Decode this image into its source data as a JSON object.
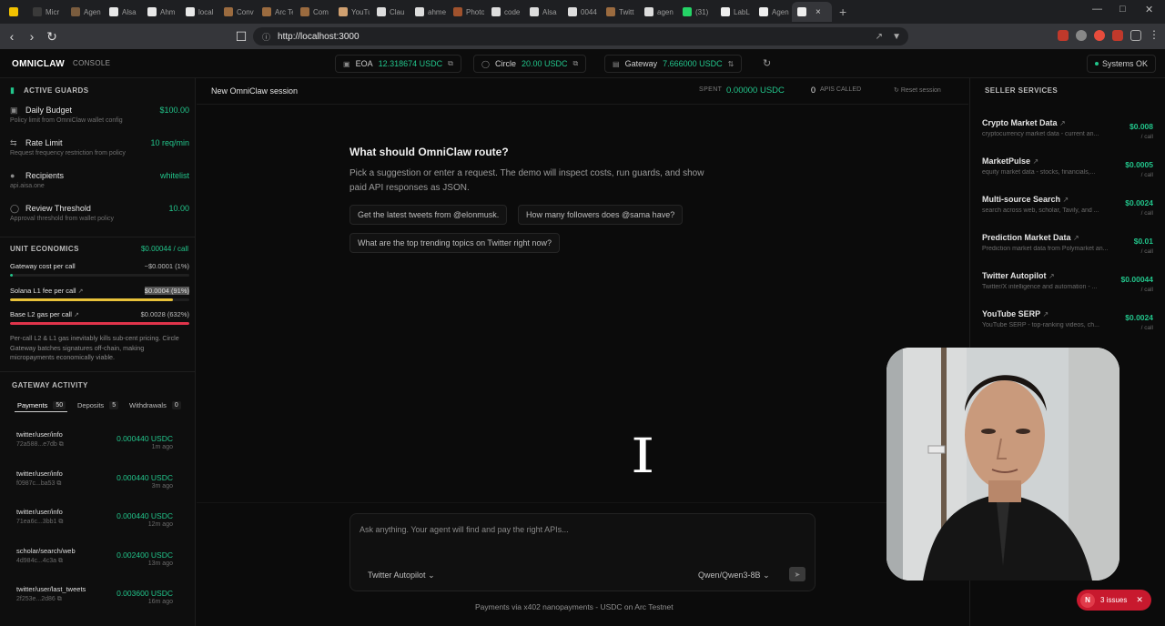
{
  "browser": {
    "tabs": [
      "Micr",
      "Agen",
      "Alsa",
      "Ahm",
      "local",
      "Conv",
      "Arc Te",
      "Com",
      "YouTu",
      "Clau",
      "ahme",
      "Photo",
      "code",
      "Alsa",
      "0044",
      "Twitt",
      "agen",
      "(31)",
      "LabL",
      "Agen",
      ""
    ],
    "url": "http://localhost:3000"
  },
  "header": {
    "logo": "OMNICLAW",
    "console": "CONSOLE",
    "wallets": [
      {
        "label": "EOA",
        "value": "12.318674 USDC"
      },
      {
        "label": "Circle",
        "value": "20.00 USDC"
      },
      {
        "label": "Gateway",
        "value": "7.666000 USDC"
      }
    ],
    "status": "Systems OK"
  },
  "guards": {
    "title": "ACTIVE GUARDS",
    "items": [
      {
        "name": "Daily Budget",
        "value": "$100.00",
        "sub": "Policy limit from OmniClaw wallet config"
      },
      {
        "name": "Rate Limit",
        "value": "10 req/min",
        "sub": "Request frequency restriction from policy"
      },
      {
        "name": "Recipients",
        "value": "whitelist",
        "sub": "api.aisa.one"
      },
      {
        "name": "Review Threshold",
        "value": "10.00",
        "sub": "Approval threshold from wallet policy"
      }
    ]
  },
  "economics": {
    "title": "UNIT ECONOMICS",
    "value": "$0.00044 / call",
    "rows": [
      {
        "label": "Gateway cost per call",
        "value": "~$0.0001 (1%)",
        "fill": 0.01,
        "color": "#22c58b"
      },
      {
        "label": "Solana L1 fee per call",
        "value": "$0.0004 (91%)",
        "fill": 0.91,
        "color": "#e8c23a"
      },
      {
        "label": "Base L2 gas per call",
        "value": "$0.0028 (632%)",
        "fill": 1.0,
        "color": "#e0344b"
      }
    ],
    "note": "Per-call L2 & L1 gas inevitably kills sub-cent pricing. Circle Gateway batches signatures off-chain, making micropayments economically viable."
  },
  "activity": {
    "title": "GATEWAY ACTIVITY",
    "tabs": [
      {
        "label": "Payments",
        "count": "50"
      },
      {
        "label": "Deposits",
        "count": "5"
      },
      {
        "label": "Withdrawals",
        "count": "0"
      }
    ],
    "items": [
      {
        "endpoint": "twitter/user/info",
        "hash": "72a588...e7db",
        "amount": "0.000440 USDC",
        "ago": "1m ago"
      },
      {
        "endpoint": "twitter/user/info",
        "hash": "f0987c...ba53",
        "amount": "0.000440 USDC",
        "ago": "3m ago"
      },
      {
        "endpoint": "twitter/user/info",
        "hash": "71ea6c...3bb1",
        "amount": "0.000440 USDC",
        "ago": "12m ago"
      },
      {
        "endpoint": "scholar/search/web",
        "hash": "4d984c...4c3a",
        "amount": "0.002400 USDC",
        "ago": "13m ago"
      },
      {
        "endpoint": "twitter/user/last_tweets",
        "hash": "2f253e...2d86",
        "amount": "0.003600 USDC",
        "ago": "16m ago"
      }
    ]
  },
  "session": {
    "title": "New OmniClaw session",
    "spent_label": "SPENT",
    "spent_value": "0.00000 USDC",
    "apis_count": "0",
    "apis_label": "APIS CALLED",
    "reset": "Reset session"
  },
  "prompt": {
    "title": "What should OmniClaw route?",
    "subtitle": "Pick a suggestion or enter a request. The demo will inspect costs, run guards, and show paid API responses as JSON.",
    "suggestions": [
      "Get the latest tweets from @elonmusk.",
      "How many followers does @sama have?",
      "What are the top trending topics on Twitter right now?"
    ]
  },
  "composer": {
    "placeholder": "Ask anything. Your agent will find and pay the right APIs...",
    "agent": "Twitter Autopilot",
    "model": "Qwen/Qwen3-8B"
  },
  "footer": "Payments via x402 nanopayments - USDC on Arc Testnet",
  "seller": {
    "title": "SELLER SERVICES",
    "items": [
      {
        "name": "Crypto Market Data",
        "desc": "cryptocurrency market data - current an...",
        "price": "$0.008",
        "unit": "/ call"
      },
      {
        "name": "MarketPulse",
        "desc": "equity market data - stocks, financials,...",
        "price": "$0.0005",
        "unit": "/ call"
      },
      {
        "name": "Multi-source Search",
        "desc": "search across web, scholar, Tavily, and ...",
        "price": "$0.0024",
        "unit": "/ call"
      },
      {
        "name": "Prediction Market Data",
        "desc": "Prediction market data from Polymarket an...",
        "price": "$0.01",
        "unit": "/ call"
      },
      {
        "name": "Twitter Autopilot",
        "desc": "Twitter/X intelligence and automation - ...",
        "price": "$0.00044",
        "unit": "/ call"
      },
      {
        "name": "YouTube SERP",
        "desc": "YouTube SERP - top-ranking videos, ch...",
        "price": "$0.0024",
        "unit": "/ call"
      }
    ]
  },
  "issues": {
    "count": "N",
    "label": "3 issues"
  }
}
